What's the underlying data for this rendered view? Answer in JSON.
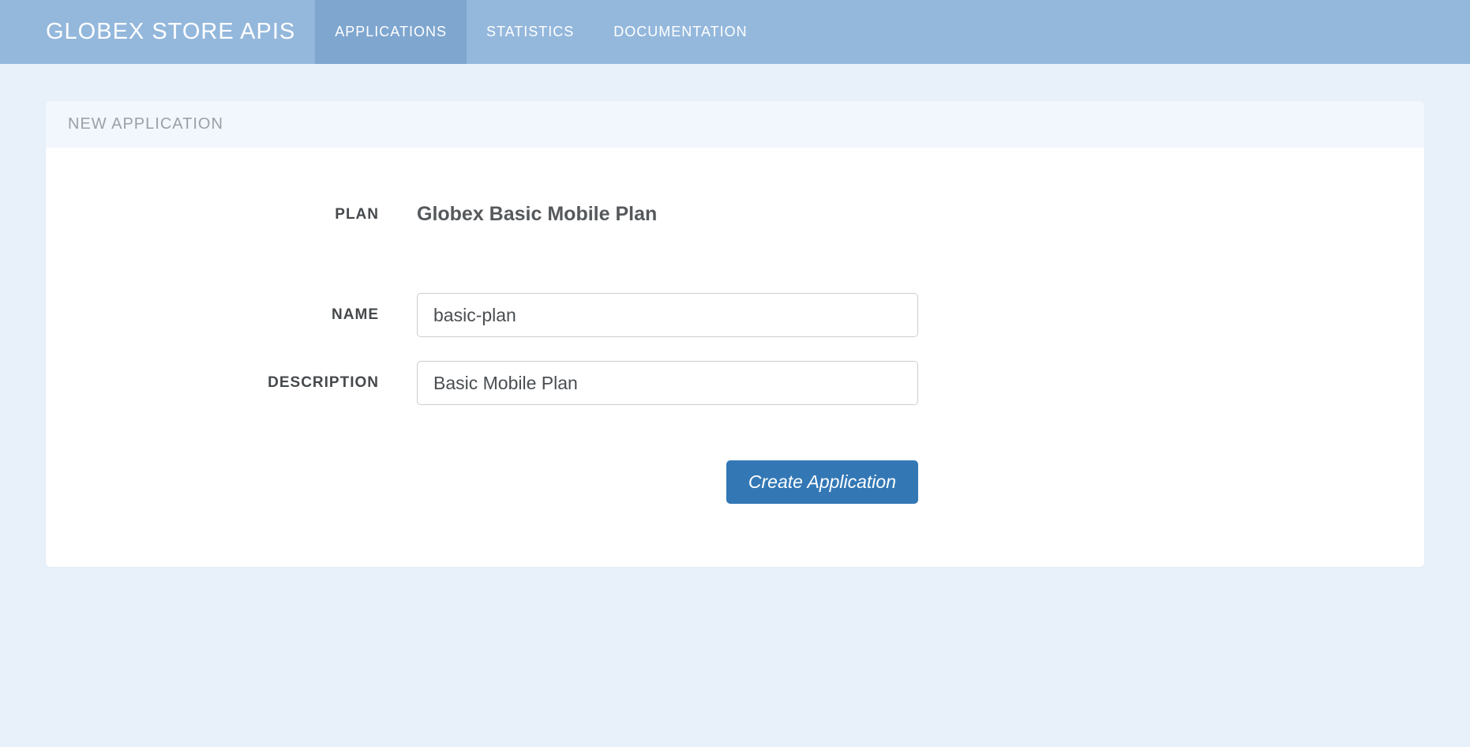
{
  "navbar": {
    "brand": "GLOBEX STORE APIS",
    "items": [
      {
        "label": "APPLICATIONS",
        "active": true
      },
      {
        "label": "STATISTICS",
        "active": false
      },
      {
        "label": "DOCUMENTATION",
        "active": false
      }
    ]
  },
  "panel": {
    "header": "NEW APPLICATION"
  },
  "form": {
    "plan_label": "PLAN",
    "plan_value": "Globex Basic Mobile Plan",
    "name_label": "NAME",
    "name_value": "basic-plan",
    "description_label": "DESCRIPTION",
    "description_value": "Basic Mobile Plan",
    "submit_label": "Create Application"
  }
}
